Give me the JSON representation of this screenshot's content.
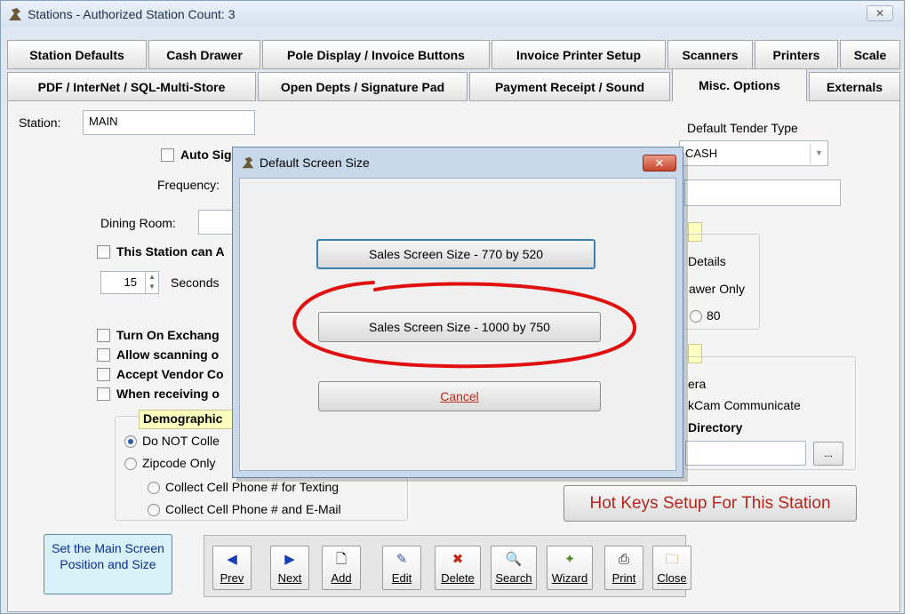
{
  "window": {
    "title": "Stations - Authorized Station Count: 3",
    "close_glyph": "✕"
  },
  "tabs_row1": [
    {
      "label": "Station Defaults"
    },
    {
      "label": "Cash Drawer"
    },
    {
      "label": "Pole Display / Invoice Buttons"
    },
    {
      "label": "Invoice Printer Setup"
    },
    {
      "label": "Scanners"
    },
    {
      "label": "Printers"
    },
    {
      "label": "Scale"
    }
  ],
  "tabs_row2": [
    {
      "label": "PDF / InterNet / SQL-Multi-Store"
    },
    {
      "label": "Open Depts / Signature Pad"
    },
    {
      "label": "Payment Receipt / Sound"
    },
    {
      "label": "Misc. Options"
    },
    {
      "label": "Externals"
    }
  ],
  "form": {
    "station_label": "Station:",
    "station_value": "MAIN",
    "auto_sig_label": "Auto Sig",
    "frequency_label": "Frequency:",
    "dining_room_label": "Dining Room:",
    "this_station_can_label": "This Station can A",
    "seconds_value": "15",
    "seconds_label": "Seconds",
    "turn_on_exchange_label": "Turn On Exchang",
    "allow_scanning_label": "Allow scanning o",
    "accept_vendor_label": "Accept Vendor Co",
    "when_receiving_label": "When receiving o",
    "demographics_label": "Demographic",
    "do_not_collect_label": "Do NOT Colle",
    "zipcode_only_label": "Zipcode Only",
    "collect_cell_texting_label": "Collect Cell Phone # for Texting",
    "collect_cell_email_label": "Collect Cell Phone # and E-Mail",
    "default_tender_type_label": "Default Tender Type",
    "default_tender_value": "CASH",
    "details_label": "Details",
    "drawer_only_label": "awer Only",
    "radio_80_label": "80",
    "camera_label": "era",
    "kcam_label": "kCam Communicate",
    "directory_label": "Directory",
    "browse_label": "...",
    "hotkeys_button_label": "Hot Keys Setup For This Station",
    "set_position_button_label": "Set the Main Screen Position and Size"
  },
  "toolbar": {
    "buttons": [
      {
        "label": "Prev",
        "icon": "◀"
      },
      {
        "label": "Next",
        "icon": "▶"
      },
      {
        "label": "Add",
        "icon": "🗋"
      },
      {
        "label": "Edit",
        "icon": "✎"
      },
      {
        "label": "Delete",
        "icon": "✖"
      },
      {
        "label": "Search",
        "icon": "🔍"
      },
      {
        "label": "Wizard",
        "icon": "✦"
      },
      {
        "label": "Print",
        "icon": "⎙"
      },
      {
        "label": "Close",
        "icon": "🗀"
      }
    ]
  },
  "dialog": {
    "title": "Default Screen Size",
    "close_glyph": "✕",
    "button_770": "Sales Screen Size - 770 by 520",
    "button_1000": "Sales Screen Size - 1000 by 750",
    "cancel": "Cancel"
  },
  "colors": {
    "hotkeys_text": "#b3261e",
    "annotation_circle": "#e01010",
    "active_radio": "#2a5fa8"
  }
}
